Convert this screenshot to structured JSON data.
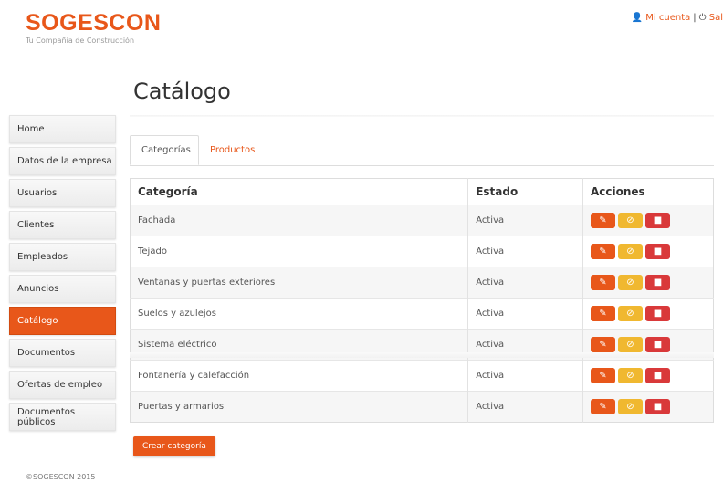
{
  "brand": {
    "name": "SOGESCON",
    "tagline": "Tu Compañía de Construcción"
  },
  "top_links": {
    "account": "Mi cuenta",
    "separator": "|",
    "logout": "Sal"
  },
  "page_title": "Catálogo",
  "sidebar": {
    "items": [
      {
        "label": "Home"
      },
      {
        "label": "Datos de la empresa"
      },
      {
        "label": "Usuarios"
      },
      {
        "label": "Clientes"
      },
      {
        "label": "Empleados"
      },
      {
        "label": "Anuncios"
      },
      {
        "label": "Catálogo"
      },
      {
        "label": "Documentos"
      },
      {
        "label": "Ofertas de empleo"
      },
      {
        "label": "Documentos públicos"
      }
    ],
    "active_index": 6
  },
  "tabs": [
    {
      "label": "Categorías"
    },
    {
      "label": "Productos"
    }
  ],
  "table": {
    "headers": {
      "category": "Categoría",
      "status": "Estado",
      "actions": "Acciones"
    },
    "rows": [
      {
        "category": "Fachada",
        "status": "Activa"
      },
      {
        "category": "Tejado",
        "status": "Activa"
      },
      {
        "category": "Ventanas y puertas exteriores",
        "status": "Activa"
      },
      {
        "category": "Suelos y azulejos",
        "status": "Activa"
      },
      {
        "category": "Sistema eléctrico",
        "status": "Activa"
      },
      {
        "category": "Fontanería y calefacción",
        "status": "Activa"
      },
      {
        "category": "Puertas y armarios",
        "status": "Activa"
      }
    ]
  },
  "create_button": "Crear categoría",
  "footer": "©SOGESCON 2015",
  "colors": {
    "accent": "#e8571a",
    "warning": "#f0b830",
    "danger": "#d9393a"
  },
  "icons": {
    "user": "user-icon",
    "power": "power-icon",
    "edit": "pencil-icon",
    "disable": "ban-icon",
    "delete": "trash-icon"
  }
}
